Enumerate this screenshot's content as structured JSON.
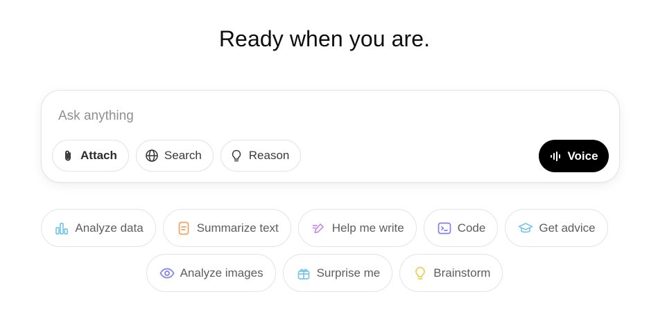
{
  "headline": "Ready when you are.",
  "composer": {
    "placeholder": "Ask anything",
    "tools": [
      {
        "label": "Attach",
        "icon": "paperclip-icon"
      },
      {
        "label": "Search",
        "icon": "globe-icon"
      },
      {
        "label": "Reason",
        "icon": "lightbulb-icon"
      }
    ],
    "voice_label": "Voice",
    "voice_icon": "voice-waveform-icon"
  },
  "suggestions": {
    "row1": [
      {
        "label": "Analyze data",
        "icon": "bar-chart-icon",
        "color": "#76c7e8"
      },
      {
        "label": "Summarize text",
        "icon": "document-icon",
        "color": "#f0a25c"
      },
      {
        "label": "Help me write",
        "icon": "pen-icon",
        "color": "#c68fe6"
      },
      {
        "label": "Code",
        "icon": "terminal-icon",
        "color": "#7f7ff0"
      },
      {
        "label": "Get advice",
        "icon": "graduation-cap-icon",
        "color": "#76c7e8"
      }
    ],
    "row2": [
      {
        "label": "Analyze images",
        "icon": "eye-icon",
        "color": "#7f7ff0"
      },
      {
        "label": "Surprise me",
        "icon": "gift-icon",
        "color": "#76c7e8"
      },
      {
        "label": "Brainstorm",
        "icon": "lightbulb-icon",
        "color": "#f2c94c"
      }
    ]
  }
}
